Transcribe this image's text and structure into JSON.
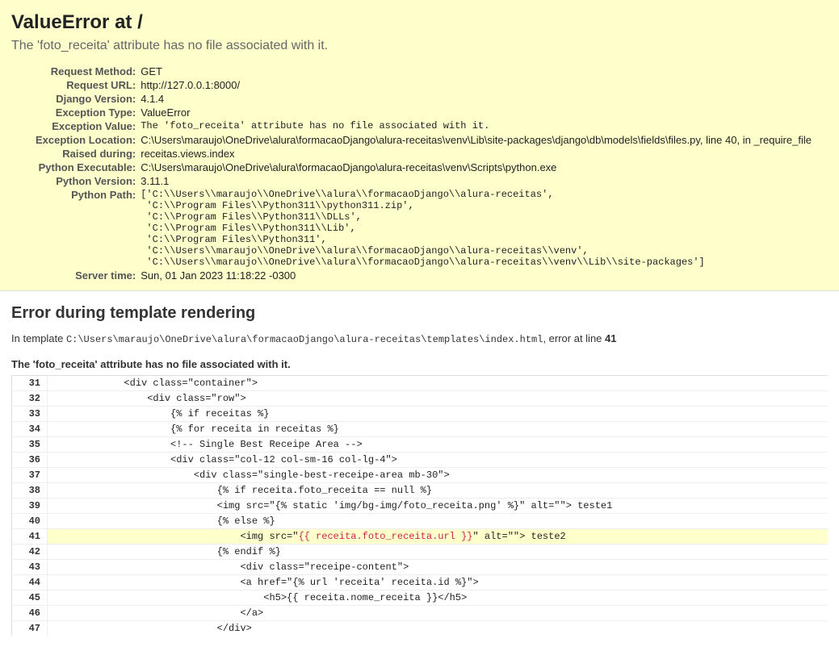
{
  "header": {
    "title": "ValueError at /",
    "exception_message": "The 'foto_receita' attribute has no file associated with it."
  },
  "meta": {
    "request_method_label": "Request Method:",
    "request_method": "GET",
    "request_url_label": "Request URL:",
    "request_url": "http://127.0.0.1:8000/",
    "django_version_label": "Django Version:",
    "django_version": "4.1.4",
    "exception_type_label": "Exception Type:",
    "exception_type": "ValueError",
    "exception_value_label": "Exception Value:",
    "exception_value": "The 'foto_receita' attribute has no file associated with it.",
    "exception_location_label": "Exception Location:",
    "exception_location": "C:\\Users\\maraujo\\OneDrive\\alura\\formacaoDjango\\alura-receitas\\venv\\Lib\\site-packages\\django\\db\\models\\fields\\files.py, line 40, in _require_file",
    "raised_during_label": "Raised during:",
    "raised_during": "receitas.views.index",
    "python_executable_label": "Python Executable:",
    "python_executable": "C:\\Users\\maraujo\\OneDrive\\alura\\formacaoDjango\\alura-receitas\\venv\\Scripts\\python.exe",
    "python_version_label": "Python Version:",
    "python_version": "3.11.1",
    "python_path_label": "Python Path:",
    "python_path": "['C:\\\\Users\\\\maraujo\\\\OneDrive\\\\alura\\\\formacaoDjango\\\\alura-receitas',\n 'C:\\\\Program Files\\\\Python311\\\\python311.zip',\n 'C:\\\\Program Files\\\\Python311\\\\DLLs',\n 'C:\\\\Program Files\\\\Python311\\\\Lib',\n 'C:\\\\Program Files\\\\Python311',\n 'C:\\\\Users\\\\maraujo\\\\OneDrive\\\\alura\\\\formacaoDjango\\\\alura-receitas\\\\venv',\n 'C:\\\\Users\\\\maraujo\\\\OneDrive\\\\alura\\\\formacaoDjango\\\\alura-receitas\\\\venv\\\\Lib\\\\site-packages']",
    "server_time_label": "Server time:",
    "server_time": "Sun, 01 Jan 2023 11:18:22 -0300"
  },
  "template": {
    "heading": "Error during template rendering",
    "intro_prefix": "In template ",
    "path": "C:\\Users\\maraujo\\OneDrive\\alura\\formacaoDjango\\alura-receitas\\templates\\index.html",
    "intro_suffix": ", error at line ",
    "error_line": "41",
    "error_title": "The 'foto_receita' attribute has no file associated with it.",
    "lines": [
      {
        "num": "31",
        "code": "            <div class=\"container\">"
      },
      {
        "num": "32",
        "code": "                <div class=\"row\">"
      },
      {
        "num": "33",
        "code": "                    {% if receitas %}"
      },
      {
        "num": "34",
        "code": "                    {% for receita in receitas %}"
      },
      {
        "num": "35",
        "code": "                    <!-- Single Best Receipe Area -->"
      },
      {
        "num": "36",
        "code": "                    <div class=\"col-12 col-sm-16 col-lg-4\">"
      },
      {
        "num": "37",
        "code": "                        <div class=\"single-best-receipe-area mb-30\">"
      },
      {
        "num": "38",
        "code": "                            {% if receita.foto_receita == null %}"
      },
      {
        "num": "39",
        "code": "                            <img src=\"{% static 'img/bg-img/foto_receita.png' %}\" alt=\"\"> teste1"
      },
      {
        "num": "40",
        "code": "                            {% else %}"
      },
      {
        "num": "41",
        "code": "                                <img src=\"",
        "hl": "{{ receita.foto_receita.url }}",
        "code2": "\" alt=\"\"> teste2",
        "error": true
      },
      {
        "num": "42",
        "code": "                            {% endif %}"
      },
      {
        "num": "43",
        "code": "                                <div class=\"receipe-content\">"
      },
      {
        "num": "44",
        "code": "                                <a href=\"{% url 'receita' receita.id %}\">"
      },
      {
        "num": "45",
        "code": "                                    <h5>{{ receita.nome_receita }}</h5>"
      },
      {
        "num": "46",
        "code": "                                </a>"
      },
      {
        "num": "47",
        "code": "                            </div>"
      }
    ]
  }
}
